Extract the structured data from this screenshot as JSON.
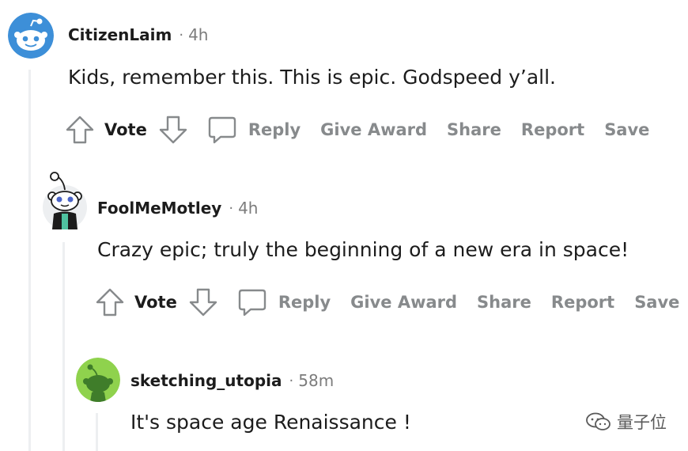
{
  "comments": [
    {
      "author": "CitizenLaim",
      "time": "4h",
      "text": "Kids, remember this. This is epic. Godspeed y’all.",
      "vote_label": "Vote",
      "actions": [
        "Reply",
        "Give Award",
        "Share",
        "Report",
        "Save"
      ]
    },
    {
      "author": "FoolMeMotley",
      "time": "4h",
      "text": "Crazy epic; truly the beginning of a new era in space!",
      "vote_label": "Vote",
      "actions": [
        "Reply",
        "Give Award",
        "Share",
        "Report",
        "Save"
      ]
    },
    {
      "author": "sketching_utopia",
      "time": "58m",
      "text": "It's space age Renaissance !"
    }
  ],
  "separator": "·",
  "watermark": "量子位",
  "colors": {
    "avatar_blue": "#3d8fd8",
    "avatar_green": "#8fd24d",
    "muted_text": "#878a8c",
    "thread_line": "#edeff1"
  }
}
